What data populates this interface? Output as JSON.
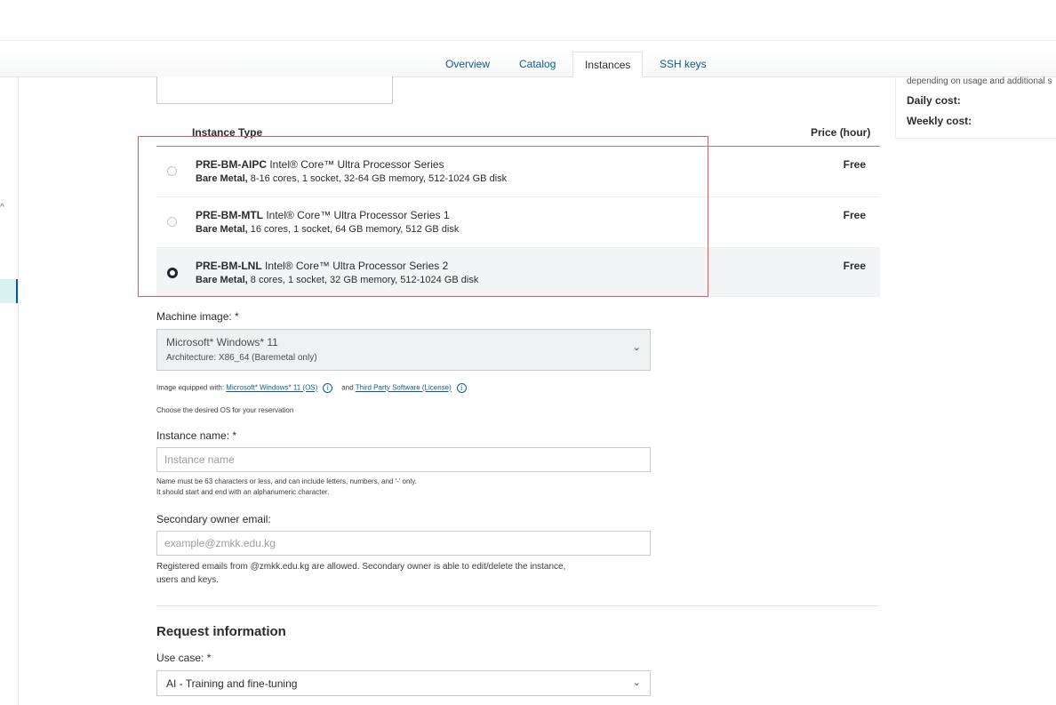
{
  "tabs": [
    {
      "label": "Overview"
    },
    {
      "label": "Catalog"
    },
    {
      "label": "Instances"
    },
    {
      "label": "SSH keys"
    }
  ],
  "cost_panel": {
    "note": "depending on usage and additional s",
    "daily_label": "Daily cost:",
    "weekly_label": "Weekly cost:"
  },
  "instance_table": {
    "header_type": "Instance Type",
    "header_price": "Price (hour)",
    "rows": [
      {
        "code": "PRE-BM-AIPC",
        "name": "Intel® Core™ Ultra Processor Series",
        "kind": "Bare Metal,",
        "specs": "8-16 cores, 1 socket, 32-64 GB memory, 512-1024 GB disk",
        "price": "Free",
        "selected": false
      },
      {
        "code": "PRE-BM-MTL",
        "name": "Intel® Core™ Ultra Processor Series 1",
        "kind": "Bare Metal,",
        "specs": "16 cores, 1 socket, 64 GB memory, 512 GB disk",
        "price": "Free",
        "selected": false
      },
      {
        "code": "PRE-BM-LNL",
        "name": "Intel® Core™ Ultra Processor Series 2",
        "kind": "Bare Metal,",
        "specs": "8 cores, 1 socket, 32 GB memory, 512-1024 GB disk",
        "price": "Free",
        "selected": true
      }
    ]
  },
  "machine_image": {
    "label": "Machine image: *",
    "value": "Microsoft* Windows* 11",
    "sub": "Architecture: X86_64 (Baremetal only)",
    "equipped_prefix": "Image equipped with:",
    "equipped_link": "Microsoft* Windows* 11 (OS)",
    "and_text": "and",
    "third_party_link": "Third Party Software (License)",
    "help": "Choose the desired OS for your reservation"
  },
  "instance_name": {
    "label": "Instance name: *",
    "placeholder": "Instance name",
    "hint1": "Name must be 63 characters or less, and can include letters, numbers, and '-' only.",
    "hint2": "It should start and end with an alphanumeric character."
  },
  "secondary_owner": {
    "label": "Secondary owner email:",
    "placeholder": "example@zmkk.edu.kg",
    "hint1": "Registered emails from @zmkk.edu.kg are allowed. Secondary owner is able to edit/delete the instance,",
    "hint2": "users and keys."
  },
  "request_info": {
    "title": "Request information",
    "use_case_label": "Use case: *",
    "use_case_value": "AI - Training and fine-tuning"
  },
  "icons": {
    "chevron_down": "⌄",
    "chevron_up": "^",
    "info": "i"
  }
}
